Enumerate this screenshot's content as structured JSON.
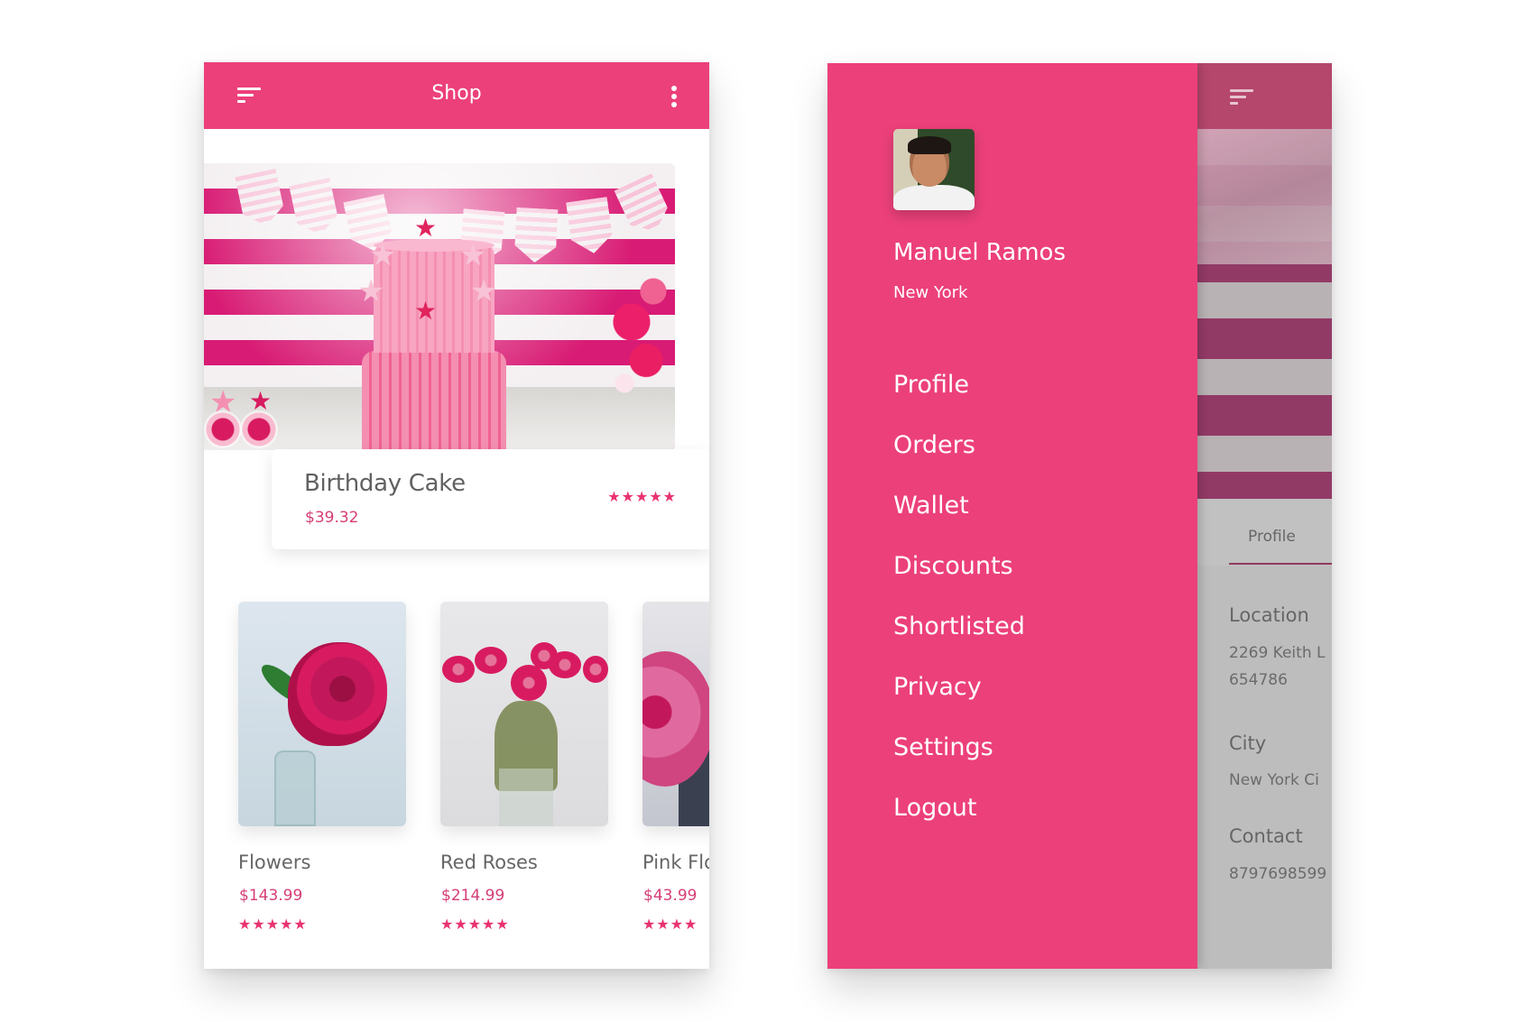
{
  "shop_screen": {
    "header": {
      "title": "Shop",
      "menu_icon": "hamburger-icon",
      "more_icon": "more-vertical-icon"
    },
    "featured": {
      "name": "Birthday Cake",
      "price": "$39.32",
      "rating": 5,
      "rating_display": "★★★★★"
    },
    "products": [
      {
        "name": "Flowers",
        "price": "$143.99",
        "rating": 5,
        "rating_display": "★★★★★"
      },
      {
        "name": "Red Roses",
        "price": "$214.99",
        "rating": 5,
        "rating_display": "★★★★★"
      },
      {
        "name": "Pink Flo",
        "price": "$43.99",
        "rating": 4,
        "rating_display": "★★★★"
      }
    ]
  },
  "drawer_screen": {
    "user": {
      "name": "Manuel Ramos",
      "city": "New York"
    },
    "menu": [
      "Profile",
      "Orders",
      "Wallet",
      "Discounts",
      "Shortlisted",
      "Privacy",
      "Settings",
      "Logout"
    ],
    "underlying": {
      "tab_label": "Profile",
      "fields": [
        {
          "label": "Location",
          "values": [
            "2269 Keith L",
            "654786"
          ]
        },
        {
          "label": "City",
          "values": [
            "New York Ci"
          ]
        },
        {
          "label": "Contact",
          "values": [
            "8797698599"
          ]
        }
      ]
    }
  },
  "colors": {
    "primary": "#ec407a",
    "price": "#d63d77",
    "star": "#e8336f",
    "dimmed_header": "#b5466c"
  }
}
